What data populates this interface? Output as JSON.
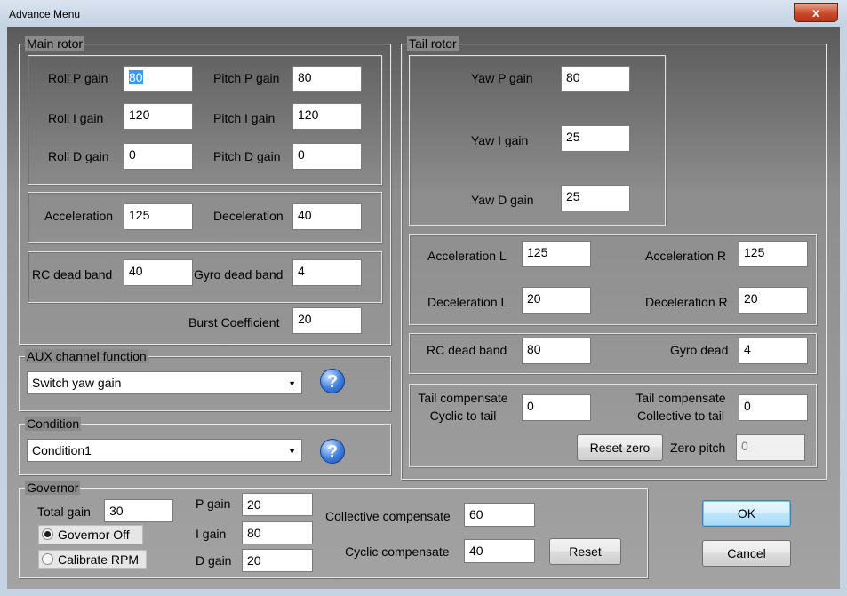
{
  "window": {
    "title": "Advance Menu",
    "close_label": "x"
  },
  "main_rotor": {
    "legend": "Main rotor",
    "roll_p_label": "Roll P gain",
    "roll_p": "80",
    "roll_i_label": "Roll I gain",
    "roll_i": "120",
    "roll_d_label": "Roll D gain",
    "roll_d": "0",
    "pitch_p_label": "Pitch P gain",
    "pitch_p": "80",
    "pitch_i_label": "Pitch I gain",
    "pitch_i": "120",
    "pitch_d_label": "Pitch D gain",
    "pitch_d": "0",
    "accel_label": "Acceleration",
    "accel": "125",
    "decel_label": "Deceleration",
    "decel": "40",
    "rc_dead_label": "RC dead band",
    "rc_dead": "40",
    "gyro_dead_label": "Gyro dead band",
    "gyro_dead": "4",
    "burst_label": "Burst Coefficient",
    "burst": "20"
  },
  "aux": {
    "legend": "AUX channel function",
    "selected": "Switch yaw gain"
  },
  "condition": {
    "legend": "Condition",
    "selected": "Condition1"
  },
  "tail_rotor": {
    "legend": "Tail rotor",
    "yaw_p_label": "Yaw P gain",
    "yaw_p": "80",
    "yaw_i_label": "Yaw I gain",
    "yaw_i": "25",
    "yaw_d_label": "Yaw D gain",
    "yaw_d": "25",
    "accel_l_label": "Acceleration L",
    "accel_l": "125",
    "accel_r_label": "Acceleration R",
    "accel_r": "125",
    "decel_l_label": "Deceleration L",
    "decel_l": "20",
    "decel_r_label": "Deceleration R",
    "decel_r": "20",
    "rc_dead_label": "RC dead band",
    "rc_dead": "80",
    "gyro_dead_label": "Gyro dead",
    "gyro_dead": "4",
    "comp_cyclic_line1": "Tail compensate",
    "comp_cyclic_line2": "Cyclic to tail",
    "comp_cyclic": "0",
    "comp_coll_line1": "Tail compensate",
    "comp_coll_line2": "Collective to tail",
    "comp_coll": "0",
    "reset_zero_label": "Reset zero",
    "zero_pitch_label": "Zero pitch",
    "zero_pitch": "0"
  },
  "governor": {
    "legend": "Governor",
    "total_gain_label": "Total gain",
    "total_gain": "30",
    "p_gain_label": "P gain",
    "p_gain": "20",
    "i_gain_label": "I gain",
    "i_gain": "80",
    "d_gain_label": "D gain",
    "d_gain": "20",
    "off_label": "Governor Off",
    "calibrate_label": "Calibrate RPM",
    "collective_label": "Collective compensate",
    "collective": "60",
    "cyclic_label": "Cyclic compensate",
    "cyclic": "40",
    "reset_label": "Reset"
  },
  "buttons": {
    "ok": "OK",
    "cancel": "Cancel"
  }
}
